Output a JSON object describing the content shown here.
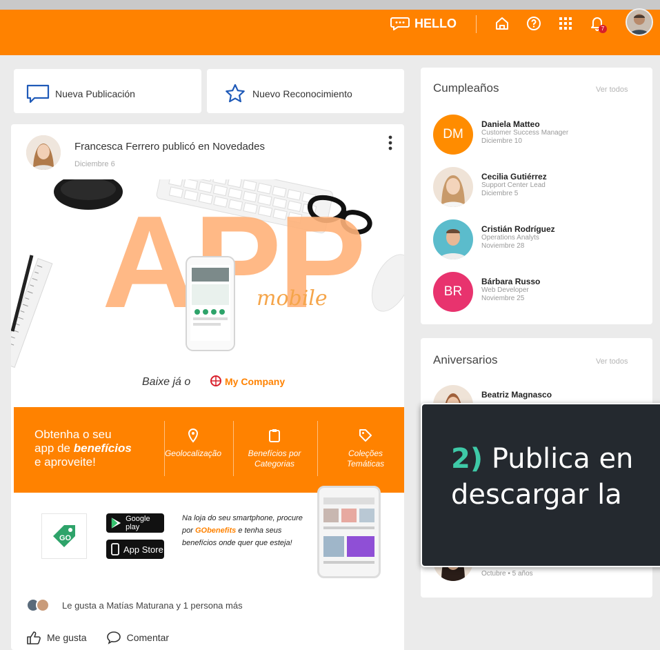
{
  "topbar": {
    "hello_label": "HELLO",
    "icons": [
      "chat-bubble-icon",
      "home-icon",
      "help-icon",
      "apps-grid-icon",
      "notification-bell-icon"
    ],
    "notification_count": "7",
    "brand_color": "#ff8200"
  },
  "actions": {
    "new_post": "Nueva Publicación",
    "new_recognition": "Nuevo Reconocimiento"
  },
  "post": {
    "author_line": "Francesca Ferrero publicó en Novedades",
    "date": "Diciembre 6",
    "hero": {
      "big_text": "APP",
      "script_text": "mobile",
      "download_prefix": "Baixe já o",
      "brand": "My Company"
    },
    "promo": {
      "line1": "Obtenha o seu",
      "line2_prefix": "app de ",
      "line2_bold": "benefícios",
      "line3": "e aproveite!",
      "features": [
        {
          "icon": "location-pin-icon",
          "label": "Geolocalização"
        },
        {
          "icon": "clipboard-icon",
          "label": "Benefícios por Categorias"
        },
        {
          "icon": "tag-icon",
          "label": "Coleções Temáticas"
        }
      ]
    },
    "stores": {
      "logo_text": "GO",
      "google_play": "Google play",
      "app_store": "App Store",
      "text_prefix": "Na loja do seu smartphone, procure por ",
      "text_brand": "GObenefits",
      "text_suffix": " e tenha seus benefícios onde quer que esteja!"
    },
    "likes_text": "Le gusta a Matías Maturana y 1 persona más",
    "like_label": "Me gusta",
    "comment_label": "Comentar"
  },
  "birthdays": {
    "title": "Cumpleaños",
    "see_all": "Ver todos",
    "people": [
      {
        "initials": "DM",
        "name": "Daniela Matteo",
        "role": "Customer Success Manager",
        "date": "Diciembre 10",
        "color": "#ff8c00"
      },
      {
        "initials": "",
        "name": "Cecilia Gutiérrez",
        "role": "Support Center Lead",
        "date": "Diciembre 5",
        "color": "#e9cdb5"
      },
      {
        "initials": "",
        "name": "Cristián Rodríguez",
        "role": "Operations Analyts",
        "date": "Noviembre 28",
        "color": "#4fb6c9"
      },
      {
        "initials": "BR",
        "name": "Bárbara Russo",
        "role": "Web Developer",
        "date": "Noviembre 25",
        "color": "#e8336e"
      }
    ]
  },
  "anniversaries": {
    "title": "Aniversarios",
    "see_all": "Ver todos",
    "first_name": "Beatriz Magnasco",
    "last_date": "Octubre • 5 años"
  },
  "tooltip": {
    "step": "2)",
    "line1": "Publica en",
    "line2": "descargar la"
  }
}
